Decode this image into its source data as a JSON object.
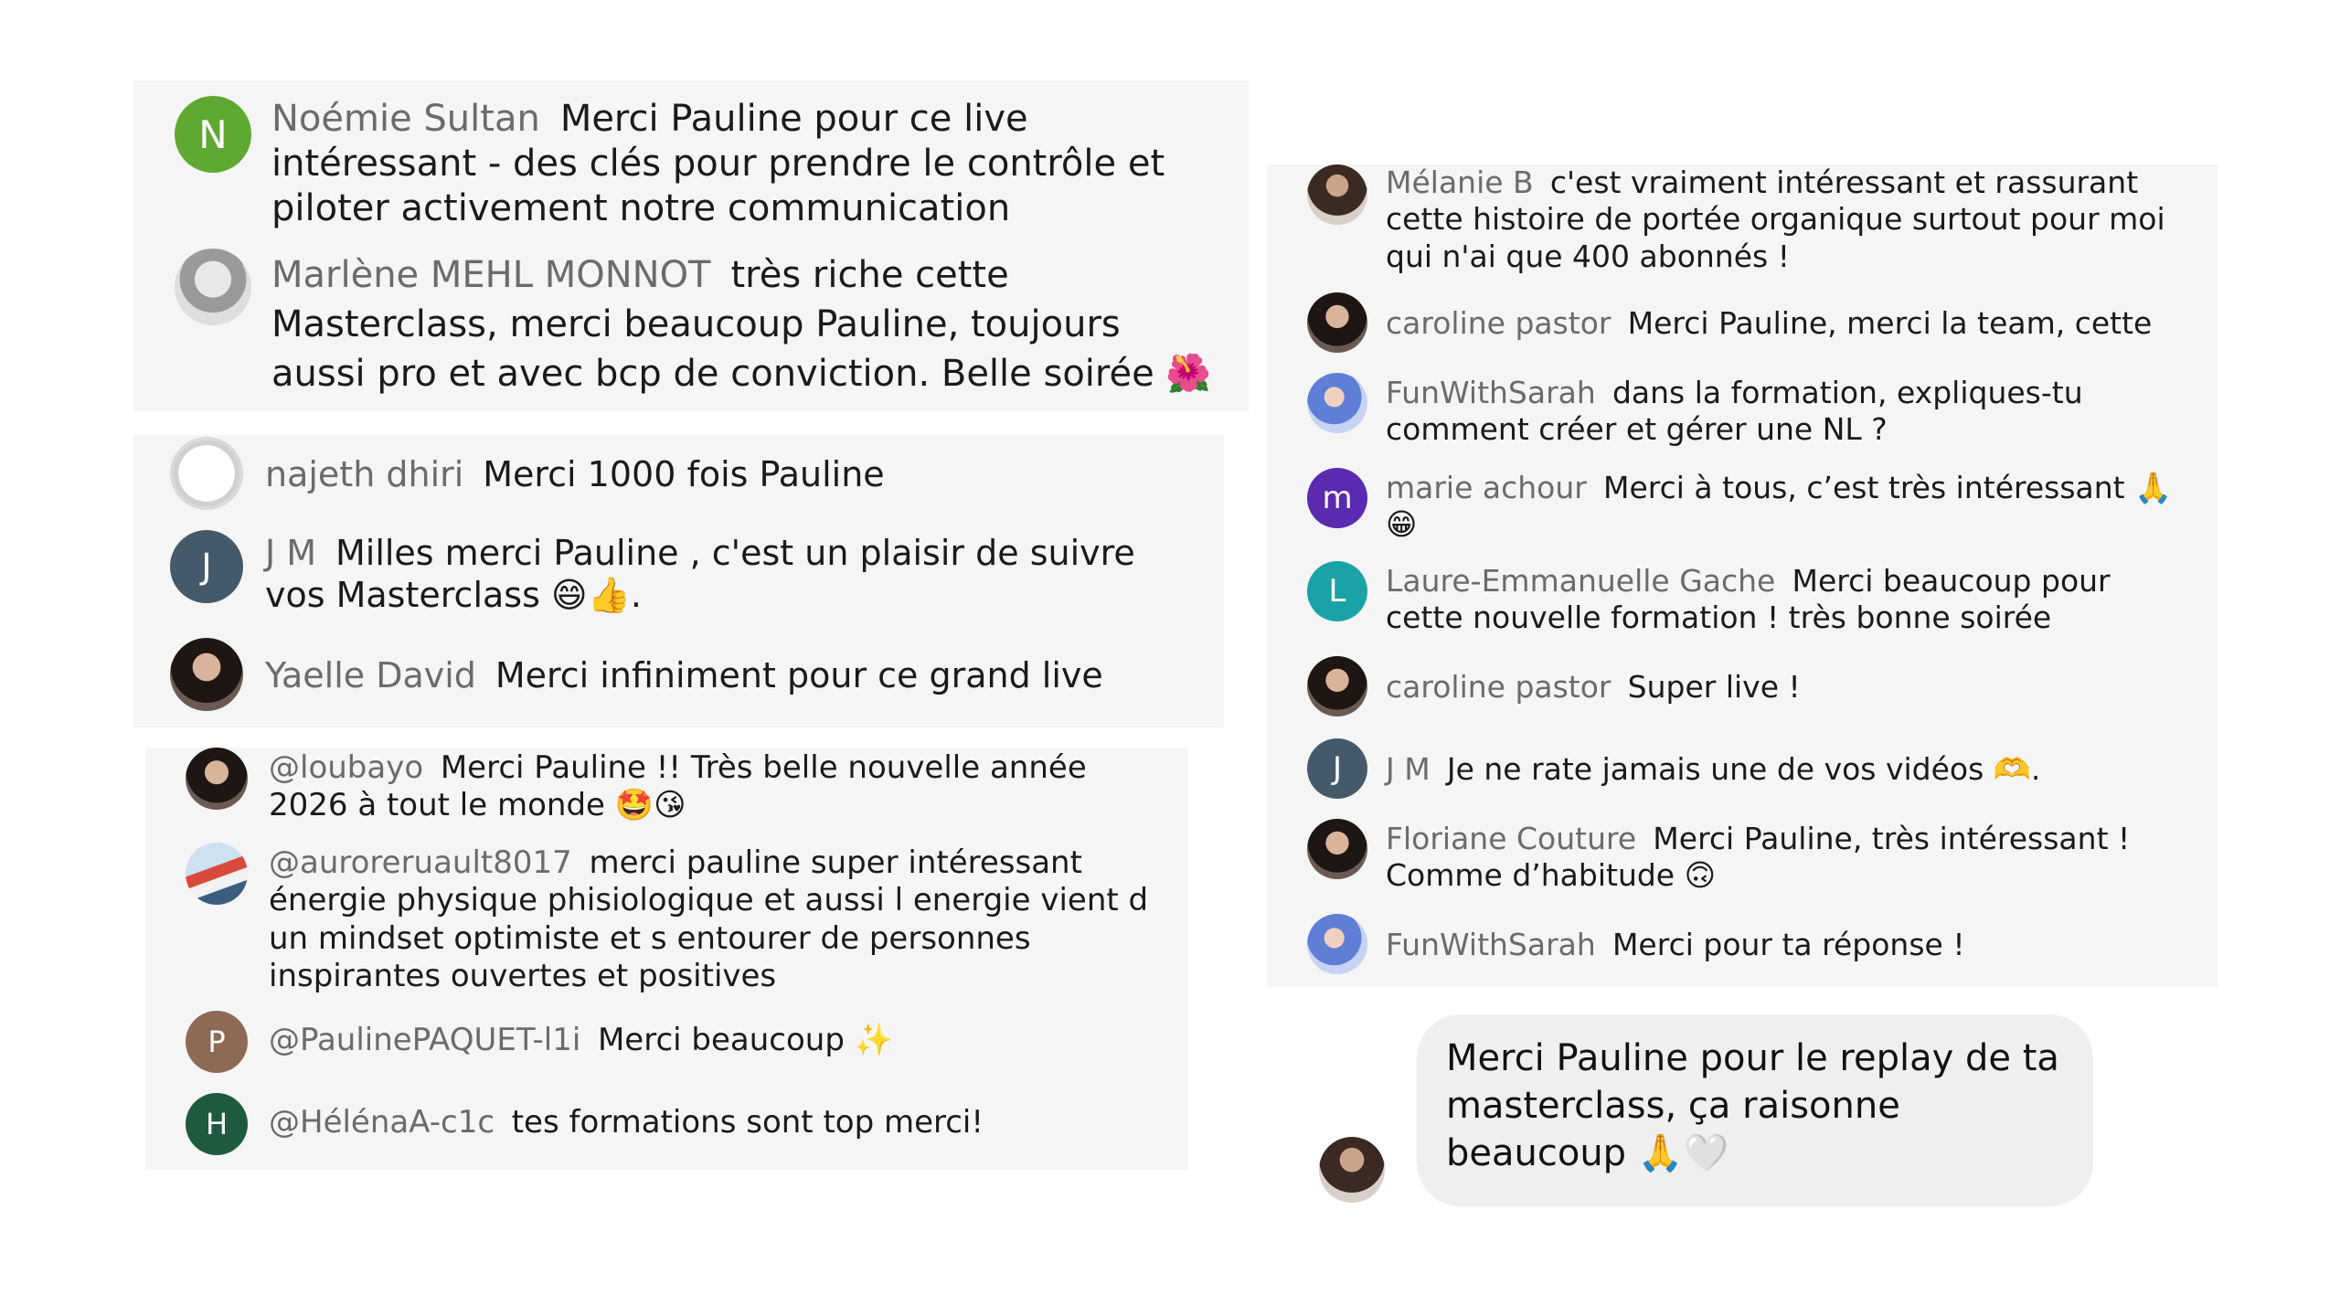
{
  "left": {
    "panel1": [
      {
        "name": "Noémie Sultan",
        "text": "Merci Pauline pour ce live intéressant - des clés pour prendre le contrôle et piloter activement notre communication",
        "initial": "N"
      },
      {
        "name": "Marlène MEHL MONNOT",
        "text": "très riche cette Masterclass, merci beaucoup Pauline, toujours aussi pro et avec bcp de conviction. Belle soirée 🌺"
      }
    ],
    "panel2": [
      {
        "name": "najeth dhiri",
        "text": "Merci 1000 fois Pauline"
      },
      {
        "name": "J M",
        "text": "Milles merci Pauline , c'est un plaisir de suivre vos Masterclass 😄👍.",
        "initial": "J"
      },
      {
        "name": "Yaelle David",
        "text": "Merci infiniment pour ce grand live"
      }
    ],
    "panel3": [
      {
        "name": "@loubayo",
        "text": "Merci Pauline !! Très belle nouvelle année 2026 à tout le monde 🤩😘"
      },
      {
        "name": "@auroreruault8017",
        "text": "merci pauline super intéressant énergie physique phisiologique et aussi l energie vient d un mindset optimiste et s entourer de personnes inspirantes ouvertes et positives"
      },
      {
        "name": "@PaulinePAQUET-l1i",
        "text": "Merci beaucoup ✨",
        "initial": "P"
      },
      {
        "name": "@HélénaA-c1c",
        "text": "tes formations sont top merci!",
        "initial": "H"
      }
    ]
  },
  "right": {
    "comments": [
      {
        "name": "Mélanie B",
        "text": "c'est vraiment intéressant et rassurant cette histoire de portée organique surtout pour moi qui n'ai que 400 abonnés !"
      },
      {
        "name": "caroline pastor",
        "text": "Merci Pauline, merci la team, cette"
      },
      {
        "name": "FunWithSarah",
        "text": "dans la formation, expliques-tu comment créer et gérer une NL ?"
      },
      {
        "name": "marie achour",
        "text": "Merci à tous, c’est très intéressant 🙏 😁",
        "initial": "m"
      },
      {
        "name": "Laure-Emmanuelle Gache",
        "text": "Merci beaucoup pour cette nouvelle formation ! très bonne soirée",
        "initial": "L"
      },
      {
        "name": "caroline pastor",
        "text": "Super live !"
      },
      {
        "name": "J M",
        "text": "Je ne rate jamais une de vos vidéos 🫶.",
        "initial": "J"
      },
      {
        "name": "Floriane Couture",
        "text": "Merci Pauline, très intéressant ! Comme d’habitude 🙃"
      },
      {
        "name": "FunWithSarah",
        "text": "Merci pour ta réponse !"
      }
    ],
    "message": {
      "text": "Merci Pauline pour le replay de ta masterclass, ça raisonne beaucoup 🙏🤍"
    }
  },
  "colors": {
    "noemie": "#5fa832",
    "jm": "#445a6b",
    "paulinepaquet": "#8c6a56",
    "helena": "#1f5a3f",
    "marie": "#5a2bb0",
    "laure": "#1aa3a6"
  }
}
